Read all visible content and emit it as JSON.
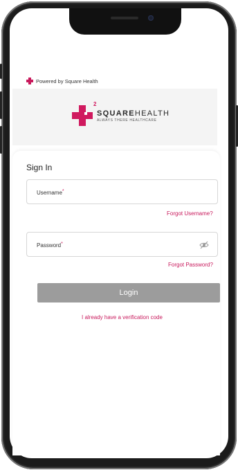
{
  "powered_by": {
    "text": "Powered by Square Health"
  },
  "logo": {
    "brand_bold": "SQUARE",
    "brand_rest": "HEALTH",
    "superscript": "2",
    "tagline": "ALWAYS THERE HEALTHCARE"
  },
  "form": {
    "title": "Sign In",
    "username": {
      "label": "Username",
      "required_mark": "*",
      "value": ""
    },
    "forgot_username": "Forgot Username?",
    "password": {
      "label": "Password",
      "required_mark": "*",
      "value": ""
    },
    "forgot_password": "Forgot Password?",
    "login_label": "Login",
    "verification_link": "I already have a verification code"
  },
  "colors": {
    "accent": "#c8195c",
    "button_disabled": "#9c9c9c"
  },
  "icons": {
    "password_toggle": "eye-icon"
  }
}
